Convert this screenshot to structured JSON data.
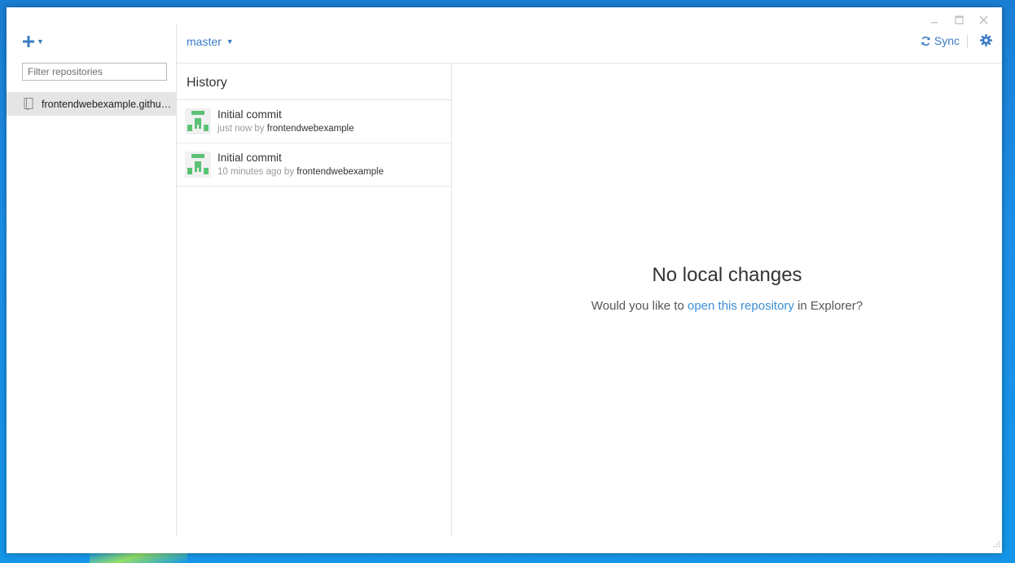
{
  "window": {
    "controls": {
      "minimize": "_",
      "maximize": "□",
      "close": "✕"
    }
  },
  "sidebar": {
    "add_icon": "plus-icon",
    "filter_placeholder": "Filter repositories",
    "repositories": [
      {
        "label": "frontendwebexample.github…",
        "icon": "repo-book-icon",
        "selected": true
      }
    ]
  },
  "toolbar": {
    "branch": "master",
    "sync_label": "Sync",
    "settings_icon": "gear-icon"
  },
  "history": {
    "title": "History",
    "commits": [
      {
        "title": "Initial commit",
        "time": "just now",
        "by": "by",
        "author": "frontendwebexample"
      },
      {
        "title": "Initial commit",
        "time": "10 minutes ago",
        "by": "by",
        "author": "frontendwebexample"
      }
    ]
  },
  "main": {
    "heading": "No local changes",
    "prompt_before": "Would you like to ",
    "prompt_link": "open this repository",
    "prompt_after": " in Explorer?"
  },
  "colors": {
    "accent": "#3b7cc4",
    "link": "#3b8fd6",
    "avatar_green": "#5bc275",
    "selected_row": "#e5e5e5"
  }
}
